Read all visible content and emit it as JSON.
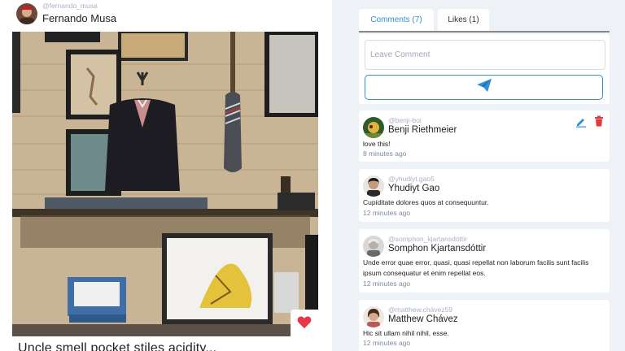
{
  "post": {
    "author_handle": "@fernando_musa",
    "author_name": "Fernando Musa",
    "caption": "Uncle smell pocket stiles acidity..."
  },
  "tabs": [
    {
      "label": "Comments (7)",
      "active": true
    },
    {
      "label": "Likes (1)",
      "active": false
    }
  ],
  "comment_form": {
    "placeholder": "Leave Comment"
  },
  "comments": [
    {
      "handle": "@benji-boi",
      "name": "Benji Riethmeier",
      "text": "love this!",
      "time": "8 minutes ago"
    },
    {
      "handle": "@yhudiyt.gao5",
      "name": "Yhudiyt Gao",
      "text": "Cupiditate dolores quos at consequuntur.",
      "time": "12 minutes ago"
    },
    {
      "handle": "@somphon_kjartansdóttir",
      "name": "Somphon Kjartansdóttir",
      "text": "Unde error quae error, quasi, quasi repellat non laborum facilis sunt facilis ipsum consequatur et enim repellat eos.",
      "time": "12 minutes ago"
    },
    {
      "handle": "@matthew.chávez59",
      "name": "Matthew Chávez",
      "text": "Hic sit ullam nihil nihil, esse.",
      "time": "12 minutes ago"
    }
  ],
  "colors": {
    "accent": "#2f8fd8",
    "like": "#e8364a",
    "delete": "#e03a3a"
  },
  "icons": {
    "send": "paper-plane-icon",
    "like": "heart-icon",
    "edit": "pencil-icon",
    "delete": "trash-icon"
  }
}
